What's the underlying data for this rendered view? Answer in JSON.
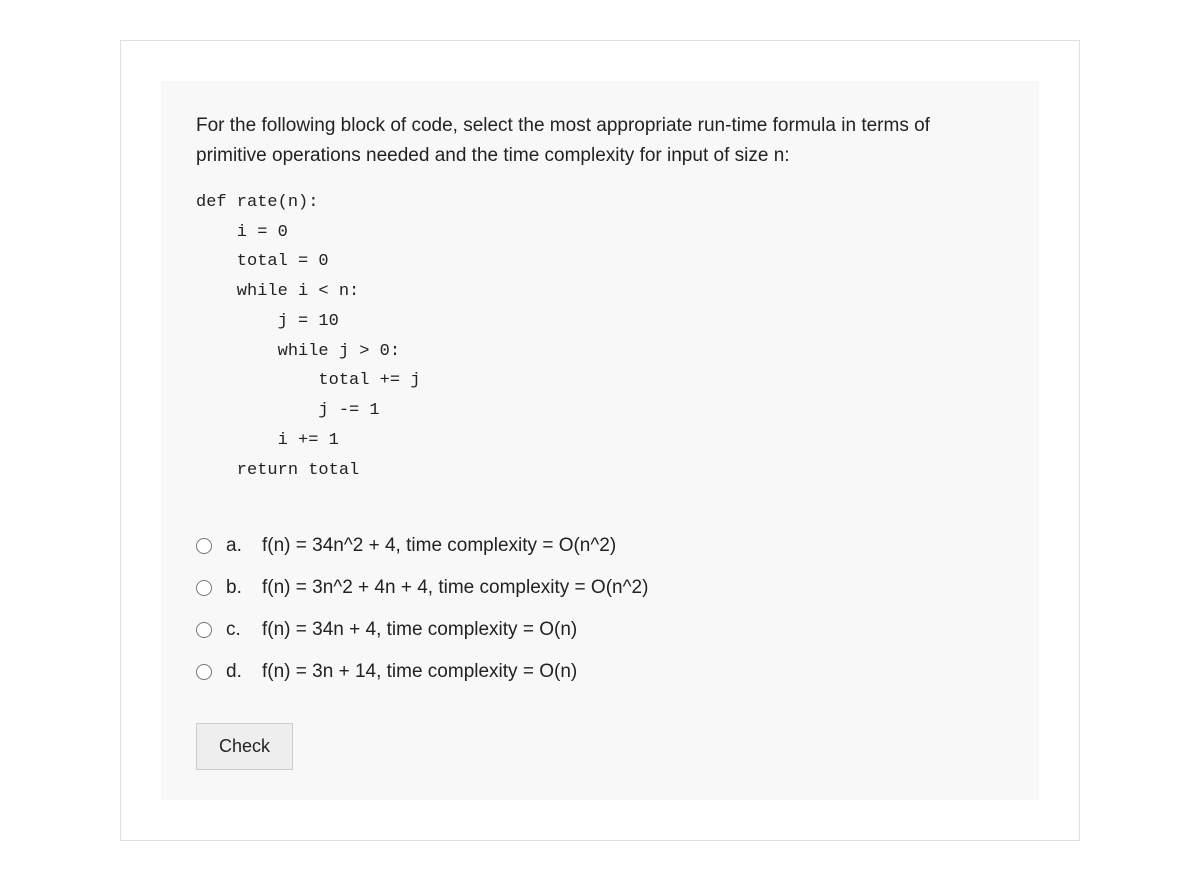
{
  "question": {
    "prompt": "For the following block of code, select the most appropriate run-time formula in terms of primitive operations needed and the time complexity for input of size n:",
    "code": "def rate(n):\n    i = 0\n    total = 0\n    while i < n:\n        j = 10\n        while j > 0:\n            total += j\n            j -= 1\n        i += 1\n    return total"
  },
  "options": [
    {
      "letter": "a.",
      "text": "f(n) = 34n^2 + 4, time complexity = O(n^2)"
    },
    {
      "letter": "b.",
      "text": "f(n) = 3n^2 + 4n + 4, time complexity = O(n^2)"
    },
    {
      "letter": "c.",
      "text": "f(n) = 34n + 4, time complexity = O(n)"
    },
    {
      "letter": "d.",
      "text": "f(n) = 3n + 14, time complexity = O(n)"
    }
  ],
  "buttons": {
    "check_label": "Check"
  }
}
